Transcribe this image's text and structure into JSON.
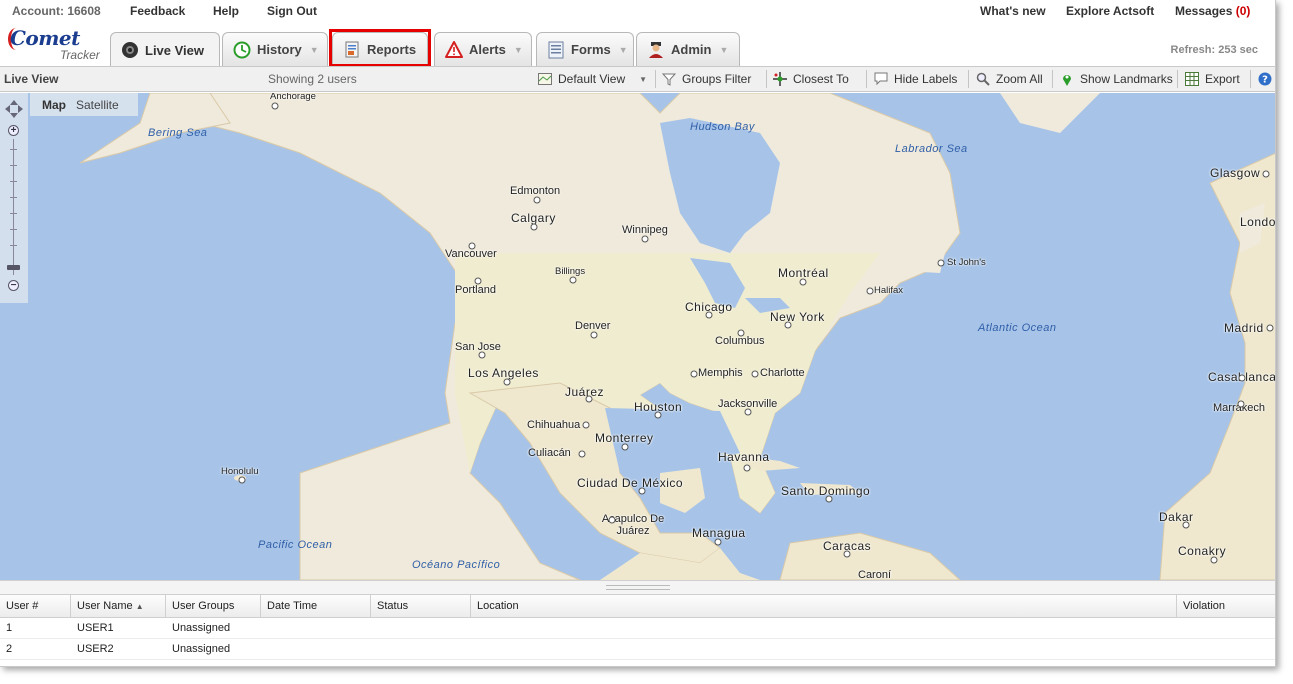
{
  "top_links": {
    "account": "Account: 16608",
    "feedback": "Feedback",
    "help": "Help",
    "sign_out": "Sign Out",
    "whats_new": "What's new",
    "explore": "Explore Actsoft",
    "messages_label": "Messages",
    "messages_count": "(0)"
  },
  "logo": {
    "line1": "Comet",
    "line2": "Tracker"
  },
  "tabs": [
    {
      "label": "Live View",
      "active": true
    },
    {
      "label": "History"
    },
    {
      "label": "Reports",
      "highlighted": true
    },
    {
      "label": "Alerts"
    },
    {
      "label": "Forms"
    },
    {
      "label": "Admin"
    }
  ],
  "refresh": "Refresh: 253 sec",
  "toolbar": {
    "title": "Live View",
    "showing": "Showing 2 users",
    "default_view": "Default View",
    "groups_filter": "Groups Filter",
    "closest_to": "Closest To",
    "hide_labels": "Hide Labels",
    "zoom_all": "Zoom All",
    "show_landmarks": "Show Landmarks",
    "export": "Export"
  },
  "map": {
    "type_map": "Map",
    "type_satellite": "Satellite",
    "cities": [
      "Anchorage",
      "Edmonton",
      "Calgary",
      "Winnipeg",
      "Vancouver",
      "Billings",
      "Portland",
      "Montréal",
      "St John's",
      "Halifax",
      "Chicago",
      "New York",
      "Columbus",
      "Denver",
      "San Jose",
      "Los Angeles",
      "Memphis",
      "Charlotte",
      "Juárez",
      "Houston",
      "Jacksonville",
      "Chihuahua",
      "Monterrey",
      "Culiacán",
      "Havanna",
      "Honolulu",
      "Ciudad De México",
      "Santo Domingo",
      "Acapulco De Juárez",
      "Managua",
      "Caracas",
      "Caroní",
      "Glasgow",
      "Londo",
      "Madrid",
      "Casablanca",
      "Marrakech",
      "Dakar",
      "Conakry"
    ],
    "waters": [
      "Bering Sea",
      "Hudson Bay",
      "Labrador Sea",
      "Atlantic Ocean",
      "Pacific Ocean",
      "Océano Pacífico"
    ]
  },
  "grid": {
    "columns": [
      "User #",
      "User Name",
      "User Groups",
      "Date Time",
      "Status",
      "Location",
      "Violation"
    ],
    "rows": [
      {
        "num": "1",
        "name": "USER1",
        "group": "Unassigned"
      },
      {
        "num": "2",
        "name": "USER2",
        "group": "Unassigned"
      }
    ]
  }
}
